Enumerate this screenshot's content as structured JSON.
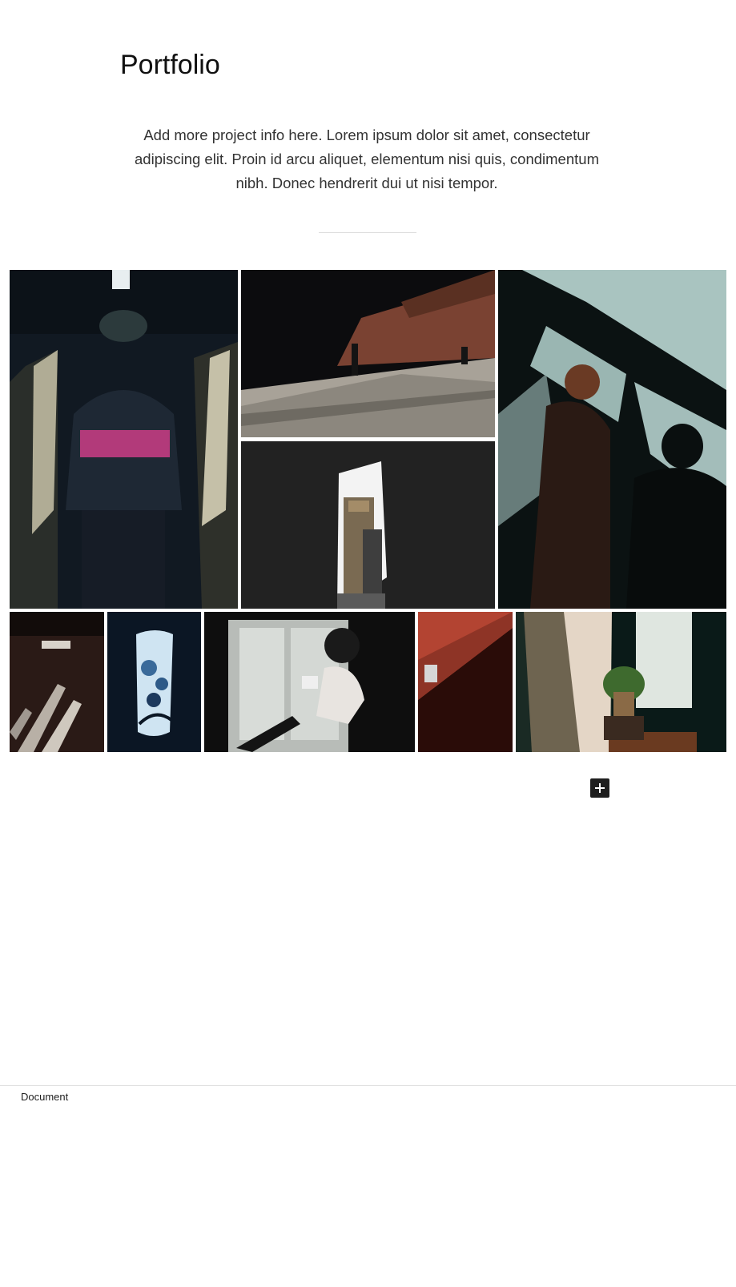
{
  "page": {
    "title": "Portfolio",
    "description": "Add more project info here. Lorem ipsum dolor sit amet, consectetur adipiscing elit. Proin id arcu aliquet, elementum nisi quis, condimentum nibh. Donec hendrerit dui ut nisi tempor."
  },
  "gallery": {
    "images": [
      {
        "subject": "person-in-hooded-jacket-corridor",
        "palette": [
          "#121a24",
          "#c8c2a8",
          "#b23a7a"
        ]
      },
      {
        "subject": "pedestrian-brick-wall-shadow",
        "palette": [
          "#0c0c0e",
          "#8a4a34",
          "#b0aaa0"
        ]
      },
      {
        "subject": "tower-through-wall-opening",
        "palette": [
          "#232323",
          "#f4f4f4",
          "#7a6850"
        ]
      },
      {
        "subject": "person-in-window-shadows",
        "palette": [
          "#0d1414",
          "#a9c4c0",
          "#7a3a24"
        ]
      },
      {
        "subject": "hallway-window-light",
        "palette": [
          "#2a1a16",
          "#d8d2ca",
          "#120c0a"
        ]
      },
      {
        "subject": "backlit-plant-panel",
        "palette": [
          "#0b1624",
          "#cfe4f2",
          "#3a6a9a"
        ]
      },
      {
        "subject": "woman-reading-by-window",
        "palette": [
          "#0e0e0e",
          "#d8dcd8",
          "#2a2a2a"
        ]
      },
      {
        "subject": "red-wall-lamp",
        "palette": [
          "#b34432",
          "#2a0c08",
          "#d6d6d6"
        ]
      },
      {
        "subject": "curtain-and-potted-plant",
        "palette": [
          "#0a1a18",
          "#e4d6c6",
          "#3e6a2e"
        ]
      }
    ]
  },
  "editor": {
    "add_block_icon": "plus-icon",
    "breadcrumb": "Document"
  }
}
